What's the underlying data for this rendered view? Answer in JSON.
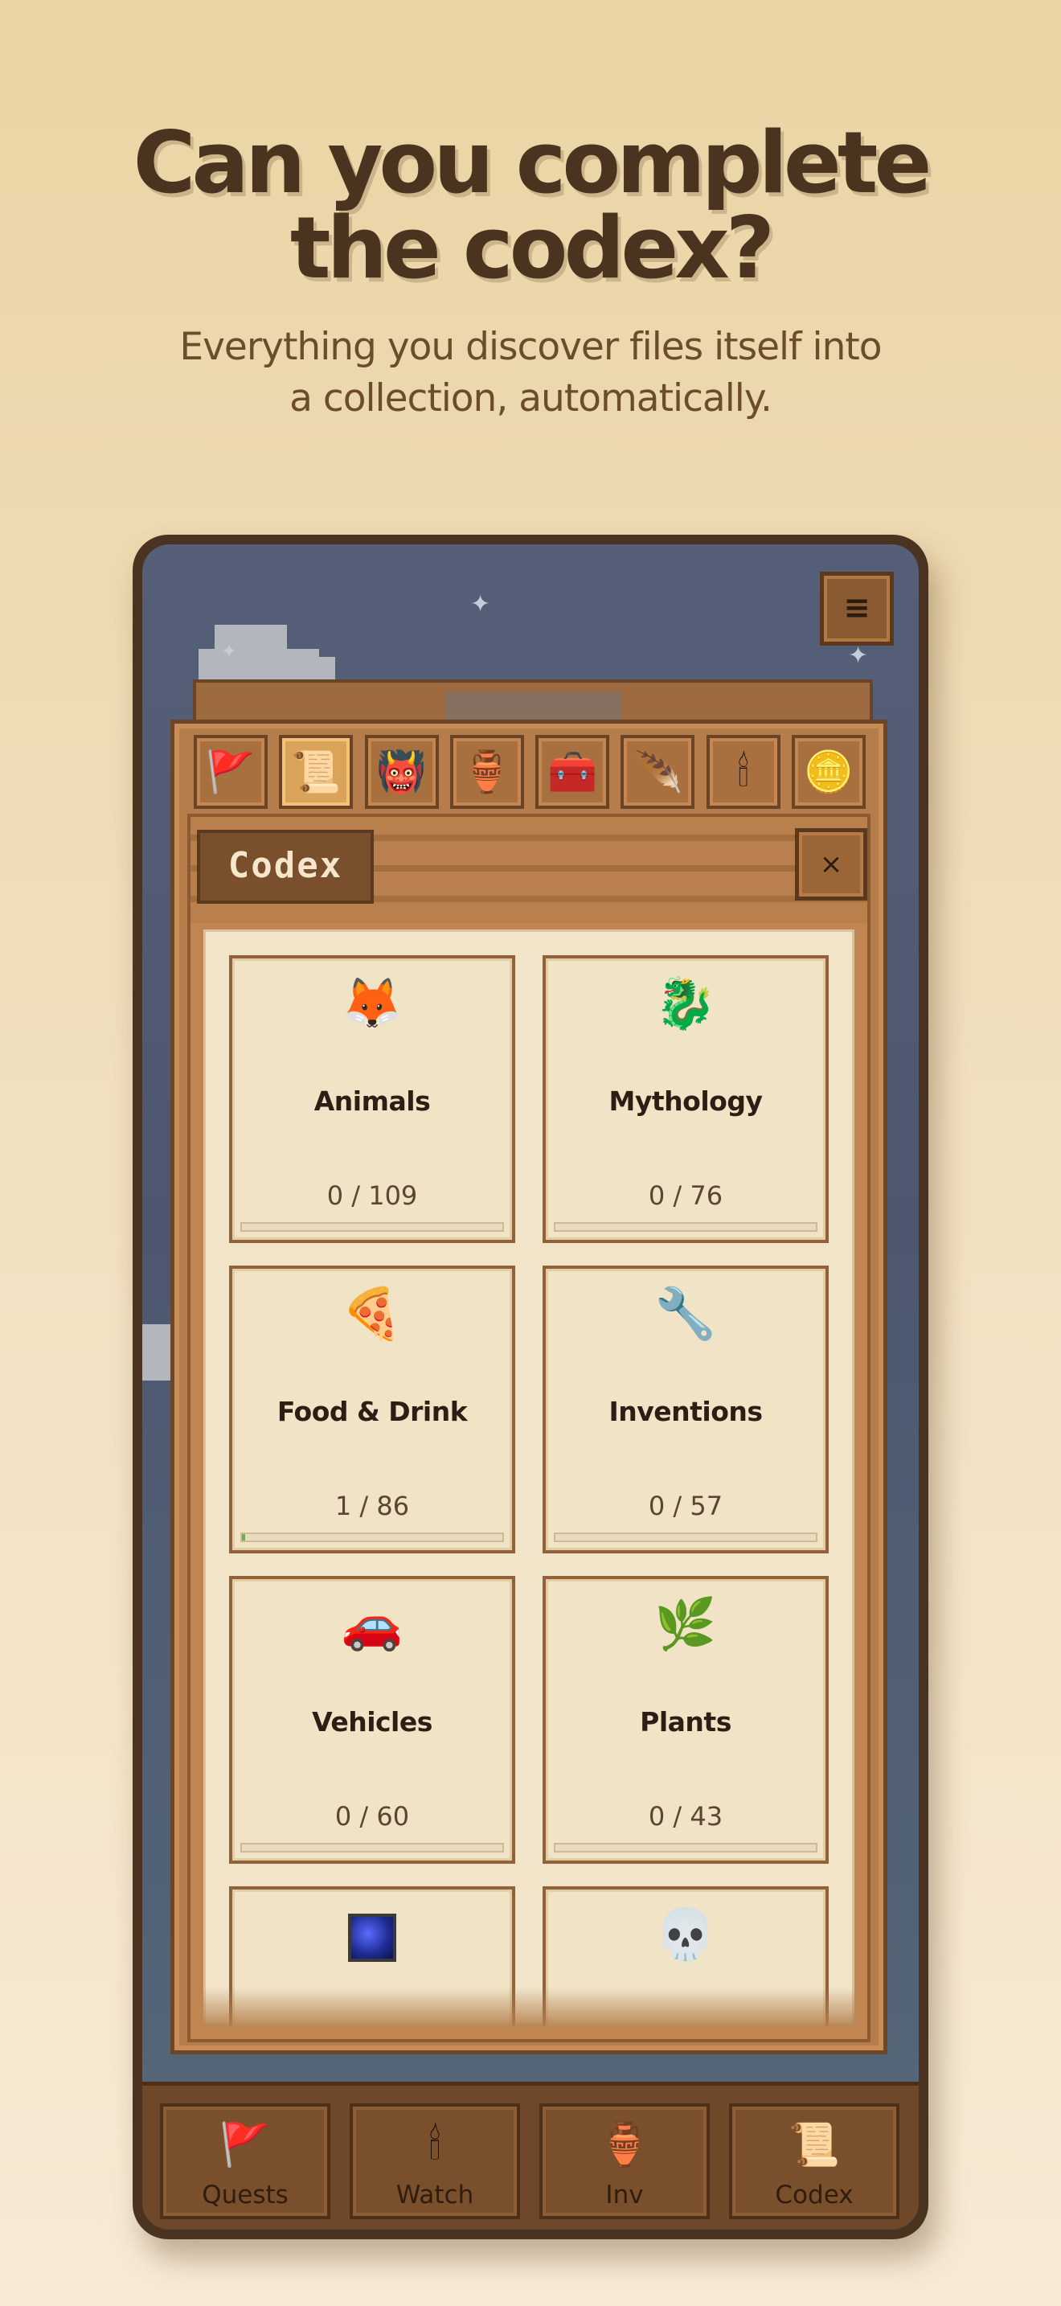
{
  "hero": {
    "title_line1": "Can you complete",
    "title_line2": "the codex?",
    "subtitle_line1": "Everything you discover files itself into",
    "subtitle_line2": "a collection, automatically."
  },
  "app": {
    "menu_icon": "≡",
    "tabs": [
      {
        "icon": "flag-icon",
        "glyph": "🚩"
      },
      {
        "icon": "scroll-icon",
        "glyph": "📜",
        "active": true
      },
      {
        "icon": "creature-icon",
        "glyph": "👹"
      },
      {
        "icon": "pouch-icon",
        "glyph": "🏺"
      },
      {
        "icon": "chest-icon",
        "glyph": "🧰"
      },
      {
        "icon": "feather-icon",
        "glyph": "🪶"
      },
      {
        "icon": "candle-icon",
        "glyph": "🕯"
      },
      {
        "icon": "coin-icon",
        "glyph": "🪙"
      }
    ],
    "panel_title": "Codex",
    "close_glyph": "×",
    "categories": [
      {
        "name": "Animals",
        "count": "0 / 109",
        "icon": "fox-icon",
        "glyph": "🦊",
        "progress": 0
      },
      {
        "name": "Mythology",
        "count": "0 / 76",
        "icon": "dragon-icon",
        "glyph": "🐉",
        "progress": 0
      },
      {
        "name": "Food & Drink",
        "count": "1 / 86",
        "icon": "pizza-icon",
        "glyph": "🍕",
        "progress": 0.0116
      },
      {
        "name": "Inventions",
        "count": "0 / 57",
        "icon": "wrench-icon",
        "glyph": "🔧",
        "progress": 0
      },
      {
        "name": "Vehicles",
        "count": "0 / 60",
        "icon": "car-icon",
        "glyph": "🚗",
        "progress": 0
      },
      {
        "name": "Plants",
        "count": "0 / 43",
        "icon": "leaf-icon",
        "glyph": "🌿",
        "progress": 0
      },
      {
        "name": "",
        "count": "",
        "icon": "space-icon",
        "glyph": "",
        "progress": 0
      },
      {
        "name": "",
        "count": "",
        "icon": "skull-icon",
        "glyph": "💀",
        "progress": 0
      }
    ],
    "nav": [
      {
        "label": "Quests",
        "icon": "flag-icon",
        "glyph": "🚩"
      },
      {
        "label": "Watch",
        "icon": "candle-icon",
        "glyph": "🕯"
      },
      {
        "label": "Inv",
        "icon": "pouch-icon",
        "glyph": "🏺"
      },
      {
        "label": "Codex",
        "icon": "scroll-icon",
        "glyph": "📜"
      }
    ]
  },
  "colors": {
    "background": "#ead4a4",
    "wood": "#b57d4c",
    "parchment": "#f1e3c6",
    "progress": "#6fae55"
  }
}
